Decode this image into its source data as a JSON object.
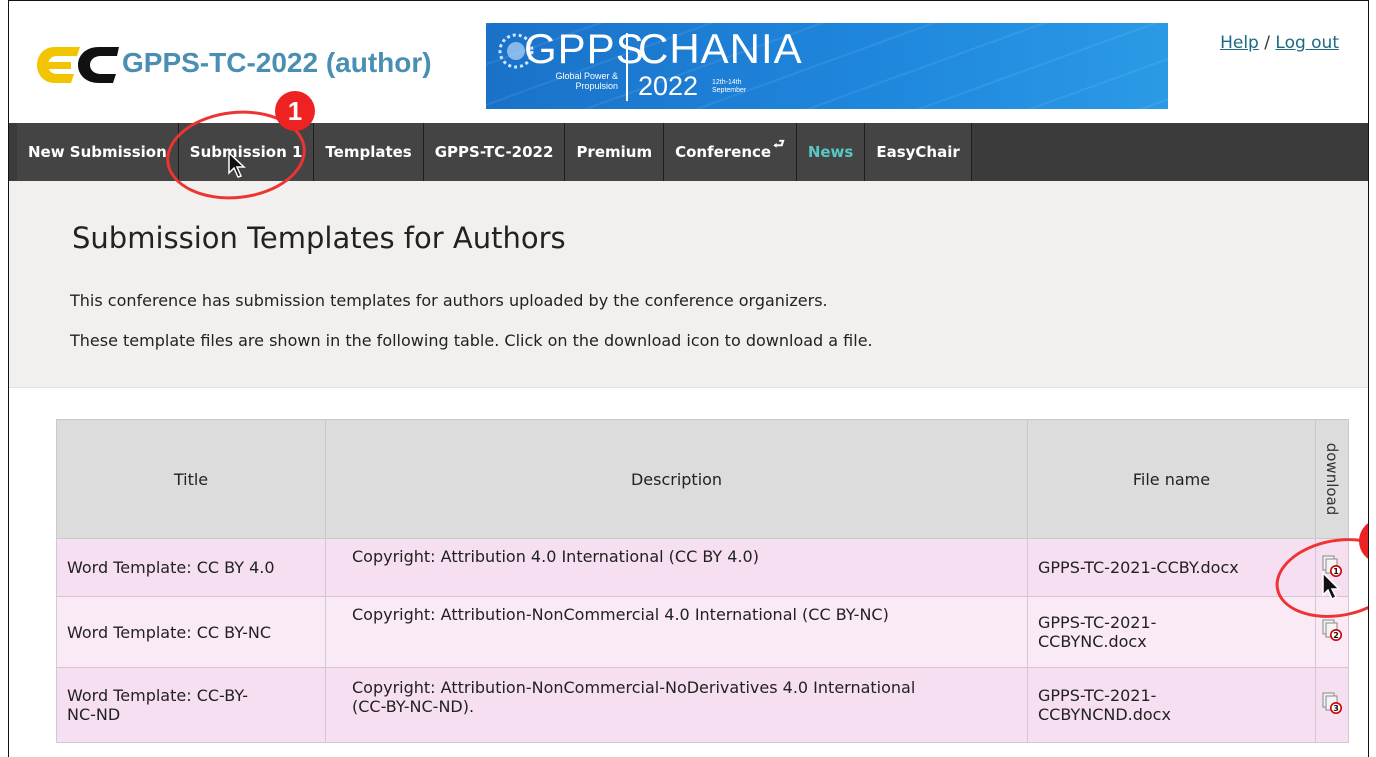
{
  "header": {
    "app_title": "GPPS-TC-2022 (author)",
    "banner": {
      "gpps": "GPPS",
      "tagline_1": "Global Power &",
      "tagline_2": "Propulsion",
      "city": "CHANIA",
      "year": "2022",
      "date_1": "12th-14th",
      "date_2": "September"
    },
    "help_label": "Help",
    "separator": "/",
    "logout_label": "Log out"
  },
  "nav": {
    "items": [
      {
        "label": "New Submission"
      },
      {
        "label": "Submission 1"
      },
      {
        "label": "Templates"
      },
      {
        "label": "GPPS-TC-2022"
      },
      {
        "label": "Premium"
      },
      {
        "label": "Conference"
      },
      {
        "label": "News"
      },
      {
        "label": "EasyChair"
      }
    ]
  },
  "page": {
    "title": "Submission Templates for Authors",
    "para_1": "This conference has submission templates for authors uploaded by the conference organizers.",
    "para_2": "These template files are shown in the following table. Click on the download icon to download a file."
  },
  "table": {
    "headers": [
      "Title",
      "Description",
      "File name",
      "download"
    ],
    "rows": [
      {
        "title": "Word Template: CC BY 4.0",
        "description": "Copyright: Attribution 4.0 International (CC BY 4.0)",
        "file_1": "GPPS-TC-2021-CCBY.docx",
        "file_2": "",
        "badge": "1"
      },
      {
        "title": "Word Template: CC BY-NC",
        "description": "Copyright: Attribution-NonCommercial 4.0 International (CC BY-NC)",
        "file_1": "GPPS-TC-2021-",
        "file_2": "CCBYNC.docx",
        "badge": "2"
      },
      {
        "title_1": "Word Template: CC-BY-",
        "title_2": "NC-ND",
        "desc_1": "Copyright: Attribution-NonCommercial-NoDerivatives 4.0 International",
        "desc_2": "(CC-BY-NC-ND).",
        "file_1": "GPPS-TC-2021-",
        "file_2": "CCBYNCND.docx",
        "badge": "3"
      }
    ]
  },
  "annotations": {
    "step_1": "1"
  },
  "colors": {
    "accent_red": "#e22222",
    "title_blue": "#4a8fb3",
    "news_teal": "#58c7c5",
    "row_pink": "#f6dff1"
  }
}
